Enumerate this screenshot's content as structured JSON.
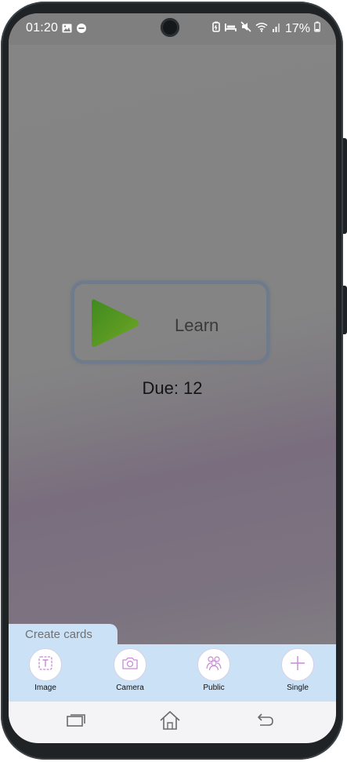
{
  "status_bar": {
    "time": "01:20",
    "battery_percent": "17%",
    "left_icons": [
      "image-icon",
      "do-not-disturb-icon"
    ],
    "right_icons": [
      "battery-saver-icon",
      "sleep-icon",
      "mute-icon",
      "wifi-icon",
      "signal-icon",
      "battery-icon"
    ]
  },
  "learn": {
    "label": "Learn",
    "play_icon": "play-icon",
    "due_text": "Due: 12"
  },
  "create_cards": {
    "tab_label": "Create cards",
    "items": [
      {
        "label": "Image",
        "icon": "text-image-icon"
      },
      {
        "label": "Camera",
        "icon": "camera-icon"
      },
      {
        "label": "Public",
        "icon": "people-icon"
      },
      {
        "label": "Single",
        "icon": "plus-icon"
      }
    ]
  },
  "nav_bar": {
    "items": [
      "recent-apps-icon",
      "home-icon",
      "back-icon"
    ]
  },
  "colors": {
    "screen_overlay": "#858585",
    "create_bar": "#cbe1f6",
    "play_green_start": "#3f8a1e",
    "play_green_end": "#6fa626",
    "icon_purple": "#c98ad8"
  }
}
